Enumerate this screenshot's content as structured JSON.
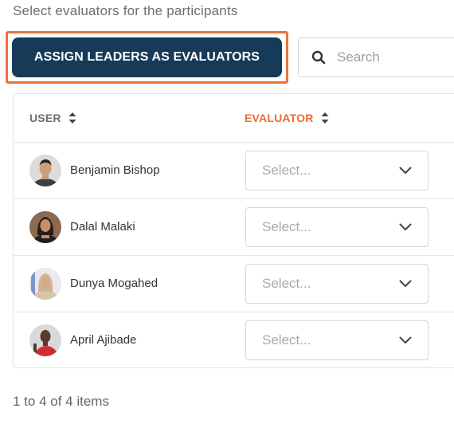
{
  "header": {
    "subtitle": "Select evaluators for the participants"
  },
  "toolbar": {
    "assign_label": "ASSIGN LEADERS AS EVALUATORS",
    "search_placeholder": "Search",
    "search_icon": "search-icon",
    "highlight_color": "#e8743b",
    "button_color": "#163a57"
  },
  "table": {
    "columns": [
      {
        "label": "USER",
        "sortable": true
      },
      {
        "label": "EVALUATOR",
        "sortable": true,
        "color": "#ee6a2f"
      }
    ],
    "rows": [
      {
        "user": "Benjamin Bishop",
        "evaluator_placeholder": "Select..."
      },
      {
        "user": "Dalal Malaki",
        "evaluator_placeholder": "Select..."
      },
      {
        "user": "Dunya Mogahed",
        "evaluator_placeholder": "Select..."
      },
      {
        "user": "April Ajibade",
        "evaluator_placeholder": "Select..."
      }
    ]
  },
  "pagination": {
    "summary": "1 to 4 of 4 items"
  }
}
